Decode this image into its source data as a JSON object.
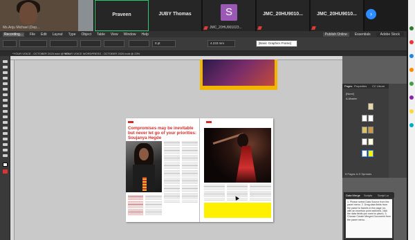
{
  "zoom": {
    "participants": [
      {
        "name": "",
        "sub": "Ms.Anju Michael (Dep...",
        "video": true
      },
      {
        "name": "Praveen",
        "sub": "",
        "active": true
      },
      {
        "name": "JUBY Thomas",
        "sub": ""
      },
      {
        "name": "",
        "avatar_letter": "S",
        "sub": "JMC_20HU901023..."
      },
      {
        "name": "JMC_20HU9010...",
        "sub": ""
      },
      {
        "name": "JMC_20HU9010...",
        "sub": ""
      }
    ],
    "next_icon": "chevron-right-icon",
    "colors": {
      "bg": "#1c1c1c",
      "active": "#2ecc71",
      "accent": "#2d8cff",
      "avatar": "#9b59b6"
    }
  },
  "indesign": {
    "window_title": "Recording...",
    "menu": [
      "File",
      "Edit",
      "Layout",
      "Type",
      "Object",
      "Table",
      "View",
      "Window",
      "Help"
    ],
    "publish_label": "Publish Online",
    "workspace": "Essentials",
    "search_placeholder": "Adobe Stock",
    "style_field": "[Basic Graphics Frame]",
    "stroke_weight": "0 pt",
    "zoom_value": "4.233 mm",
    "doc_tabs": [
      "*YOUR VOICE - OCTOBER 2020.indd @ 38%",
      "*YOUR VOICE WORDPRESS - OCTOBER 2020.indd @ 23%"
    ],
    "pages_panel": {
      "tabs": [
        "Pages",
        "Properties",
        "CC Librari"
      ],
      "items": [
        "[None]",
        "A-Master"
      ],
      "footer": "8 Pages in 5 Spreads"
    },
    "article": {
      "headline": "Compromises may be inevitable but never let go of your priorities: Soujanya Hegde",
      "brand_color": "#d72b2b",
      "highlight_color": "#fff000"
    },
    "script_panel": {
      "tabs": [
        "Data Merge",
        "Scripts",
        "Script La"
      ],
      "body": "1. Please select Data Source from the panel menu.\n2. Drag data fields from the panel to frames in the page (or, with an insertion point selected, click the data fields you want to place).\n3. Choose Create Merged Document from the panel menu."
    }
  }
}
